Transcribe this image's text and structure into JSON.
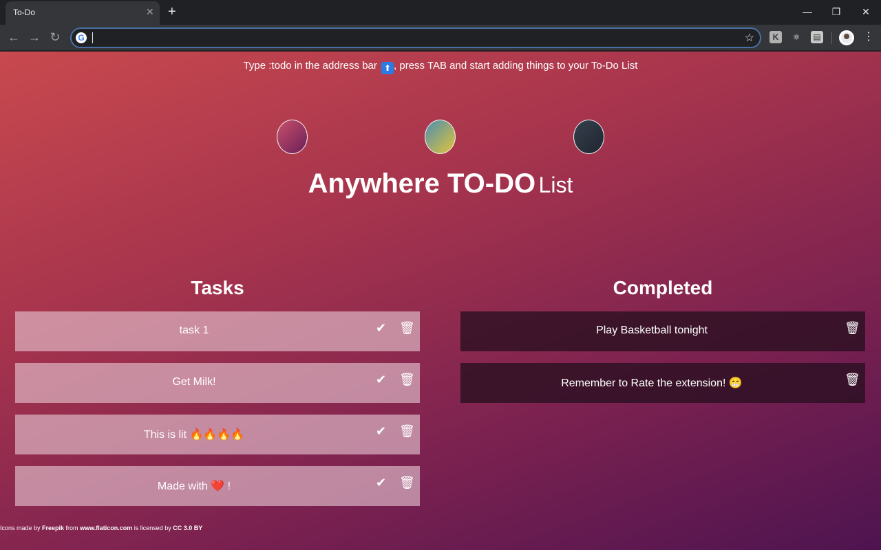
{
  "browser": {
    "tab_title": "To-Do",
    "tab_close": "✕",
    "new_tab": "+",
    "window": {
      "minimize": "—",
      "restore": "❐",
      "close": "✕"
    },
    "nav": {
      "back": "←",
      "forward": "→",
      "reload": "↻"
    },
    "omnibox": {
      "value": "",
      "engine_icon": "G",
      "star": "☆"
    },
    "extensions": [
      "K",
      "⚛",
      "▤"
    ],
    "menu": "⋮"
  },
  "page": {
    "hint": {
      "prefix": "Type :todo in the address bar",
      "arrow": "⬆",
      "suffix": ", press TAB and start adding things to your To-Do List"
    },
    "themes": [
      {
        "name": "red-purple",
        "colors": [
          "#c94f6a",
          "#6a1f5a"
        ]
      },
      {
        "name": "blue-yellow",
        "colors": [
          "#4c8fb0",
          "#e3c43a"
        ]
      },
      {
        "name": "dark",
        "colors": [
          "#36404d",
          "#1e2530"
        ]
      }
    ],
    "title_main": "Anywhere TO-DO",
    "title_sub": "List",
    "tasks_title": "Tasks",
    "completed_title": "Completed",
    "tasks": [
      {
        "text": "task 1"
      },
      {
        "text": "Get Milk!"
      },
      {
        "text": "This is lit 🔥🔥🔥🔥"
      },
      {
        "text": "Made with ❤️ !"
      }
    ],
    "completed": [
      {
        "text": "Play Basketball tonight"
      },
      {
        "text": "Remember to Rate the extension! 😁"
      }
    ],
    "icons": {
      "check": "✔",
      "trash": "🗑"
    },
    "credits": {
      "a": "Icons made by ",
      "author": "Freepik",
      "b": " from ",
      "site": "www.flaticon.com",
      "c": " is licensed by ",
      "license": "CC 3.0 BY"
    }
  }
}
